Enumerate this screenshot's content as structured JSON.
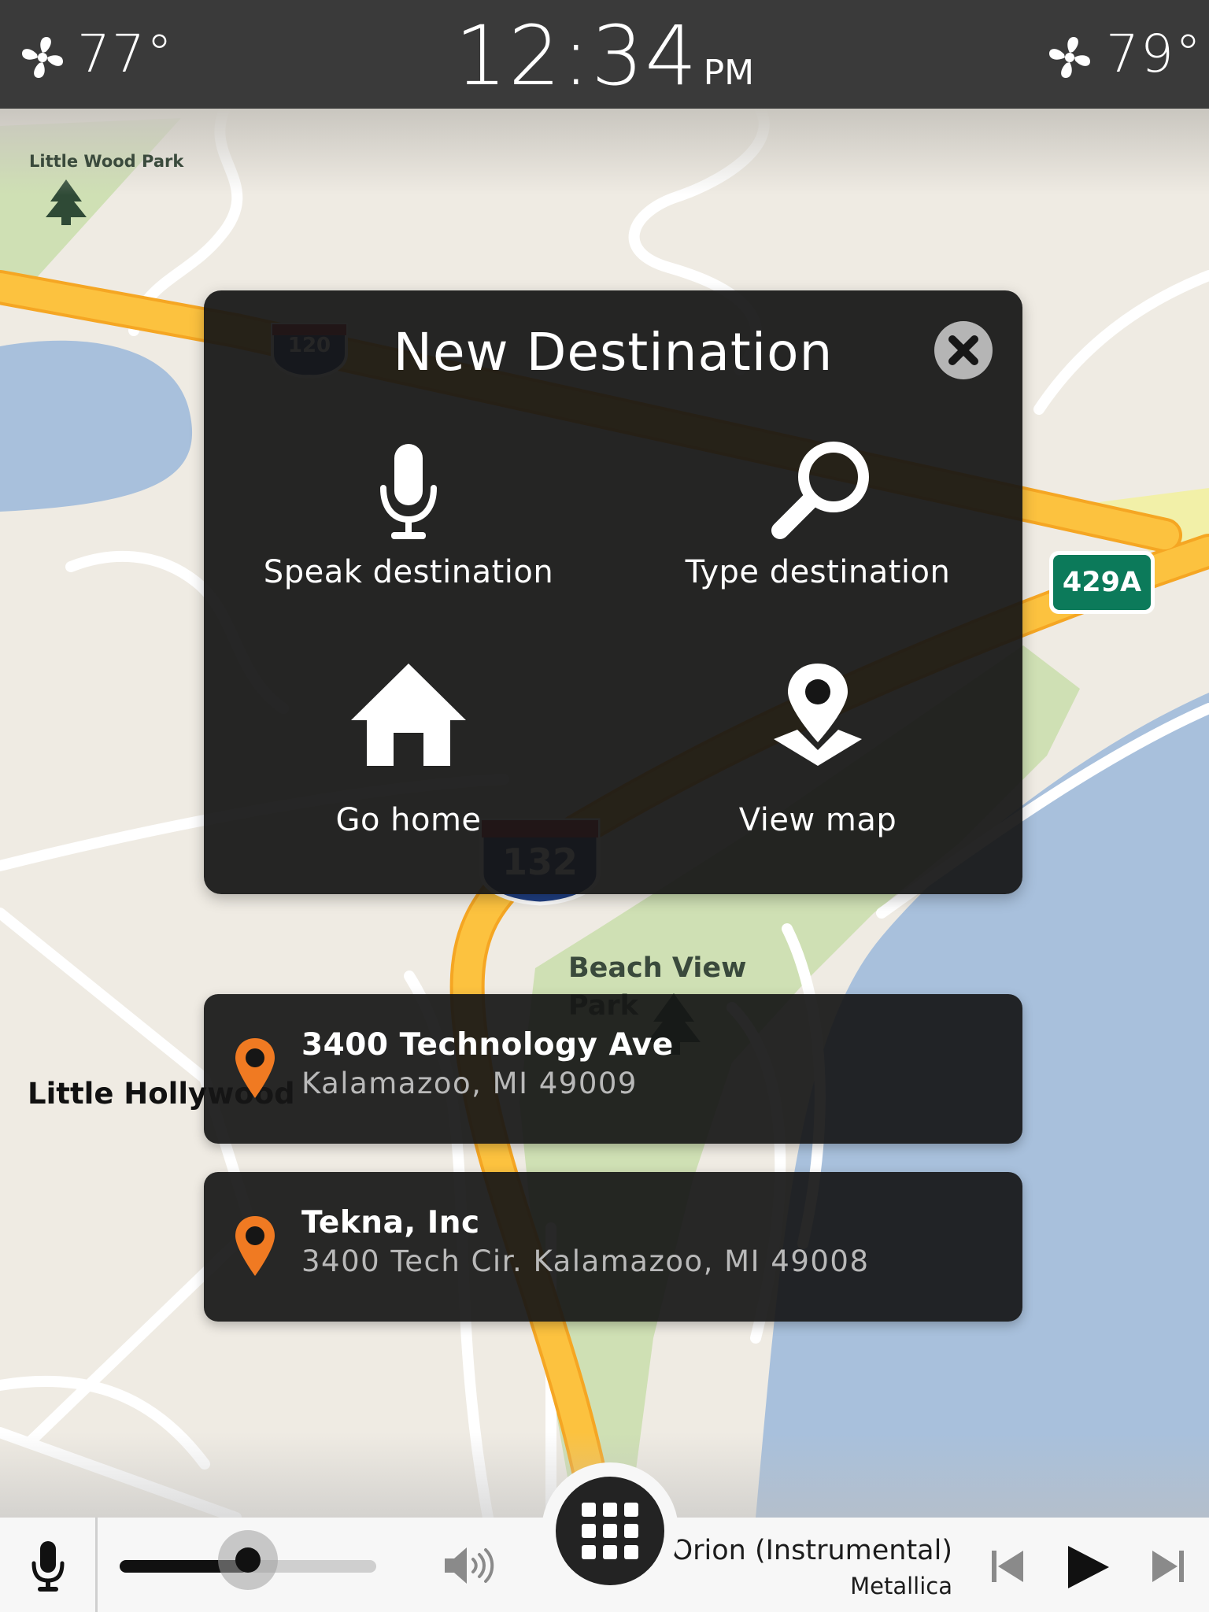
{
  "status_bar": {
    "left_temp": "77°",
    "time": "12:34",
    "ampm": "PM",
    "right_temp": "79°",
    "left_fan_icon": "fan-icon",
    "right_fan_icon": "fan-icon"
  },
  "map": {
    "park_labels": [
      "Little Wood Park",
      "Beach View Park"
    ],
    "area_label": "Little Hollywood",
    "interstate_shields": [
      "120",
      "132"
    ],
    "exit_sign": "429A",
    "colors": {
      "land": "#efebe3",
      "water": "#a8c0dc",
      "park": "#cfe0b4",
      "highway": "#fbbd3c"
    }
  },
  "dialog": {
    "title": "New Destination",
    "close_icon": "close-icon",
    "options": [
      {
        "label": "Speak destination",
        "icon": "microphone-icon"
      },
      {
        "label": "Type destination",
        "icon": "magnifier-icon"
      },
      {
        "label": "Go home",
        "icon": "home-icon"
      },
      {
        "label": "View map",
        "icon": "map-pin-icon"
      }
    ]
  },
  "results": [
    {
      "name": "3400 Technology Ave",
      "address": "Kalamazoo, MI 49009",
      "icon": "location-pin-icon"
    },
    {
      "name": "Tekna, Inc",
      "address": "3400 Tech Cir. Kalamazoo, MI 49008",
      "icon": "location-pin-icon"
    }
  ],
  "bottom_bar": {
    "mic_icon": "microphone-icon",
    "volume_level": 0.5,
    "volume_icon": "speaker-icon",
    "apps_icon": "grid-icon",
    "track_title": "Orion (Instrumental)",
    "track_artist": "Metallica",
    "prev_icon": "skip-previous-icon",
    "play_icon": "play-icon",
    "next_icon": "skip-next-icon",
    "accent_color": "#f07a22"
  }
}
